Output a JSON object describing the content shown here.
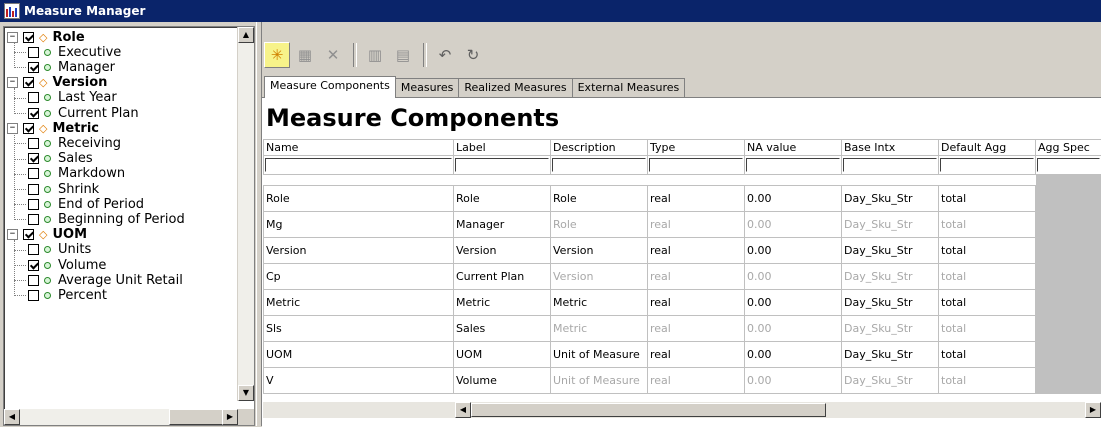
{
  "window": {
    "title": "Measure Manager"
  },
  "tree": {
    "groups": [
      {
        "label": "Role",
        "checked": true,
        "items": [
          {
            "label": "Executive",
            "checked": false
          },
          {
            "label": "Manager",
            "checked": true
          }
        ]
      },
      {
        "label": "Version",
        "checked": true,
        "items": [
          {
            "label": "Last Year",
            "checked": false
          },
          {
            "label": "Current Plan",
            "checked": true
          }
        ]
      },
      {
        "label": "Metric",
        "checked": true,
        "items": [
          {
            "label": "Receiving",
            "checked": false
          },
          {
            "label": "Sales",
            "checked": true
          },
          {
            "label": "Markdown",
            "checked": false
          },
          {
            "label": "Shrink",
            "checked": false
          },
          {
            "label": "End of Period",
            "checked": false
          },
          {
            "label": "Beginning of Period",
            "checked": false
          }
        ]
      },
      {
        "label": "UOM",
        "checked": true,
        "items": [
          {
            "label": "Units",
            "checked": false
          },
          {
            "label": "Volume",
            "checked": true
          },
          {
            "label": "Average Unit Retail",
            "checked": false
          },
          {
            "label": "Percent",
            "checked": false
          }
        ]
      }
    ]
  },
  "toolbar": {
    "icons": [
      "new-icon",
      "grid-icon",
      "delete-icon",
      "import-icon",
      "export-icon",
      "undo-icon",
      "refresh-icon"
    ]
  },
  "tabs": [
    "Measure Components",
    "Measures",
    "Realized Measures",
    "External Measures"
  ],
  "main": {
    "heading": "Measure Components"
  },
  "grid": {
    "columns": [
      "Name",
      "Label",
      "Description",
      "Type",
      "NA value",
      "Base Intx",
      "Default Agg",
      "Agg Spec"
    ],
    "rows": [
      {
        "muted": false,
        "cells": [
          "Role",
          "Role",
          "Role",
          "real",
          "0.00",
          "Day_Sku_Str",
          "total",
          ""
        ]
      },
      {
        "muted": true,
        "cells": [
          "Mg",
          "Manager",
          "Role",
          "real",
          "0.00",
          "Day_Sku_Str",
          "total",
          ""
        ]
      },
      {
        "muted": false,
        "cells": [
          "Version",
          "Version",
          "Version",
          "real",
          "0.00",
          "Day_Sku_Str",
          "total",
          ""
        ]
      },
      {
        "muted": true,
        "cells": [
          "Cp",
          "Current Plan",
          "Version",
          "real",
          "0.00",
          "Day_Sku_Str",
          "total",
          ""
        ]
      },
      {
        "muted": false,
        "cells": [
          "Metric",
          "Metric",
          "Metric",
          "real",
          "0.00",
          "Day_Sku_Str",
          "total",
          ""
        ]
      },
      {
        "muted": true,
        "cells": [
          "Sls",
          "Sales",
          "Metric",
          "real",
          "0.00",
          "Day_Sku_Str",
          "total",
          ""
        ]
      },
      {
        "muted": false,
        "cells": [
          "UOM",
          "UOM",
          "Unit of Measure",
          "real",
          "0.00",
          "Day_Sku_Str",
          "total",
          ""
        ]
      },
      {
        "muted": true,
        "cells": [
          "V",
          "Volume",
          "Unit of Measure",
          "real",
          "0.00",
          "Day_Sku_Str",
          "total",
          ""
        ]
      }
    ]
  }
}
